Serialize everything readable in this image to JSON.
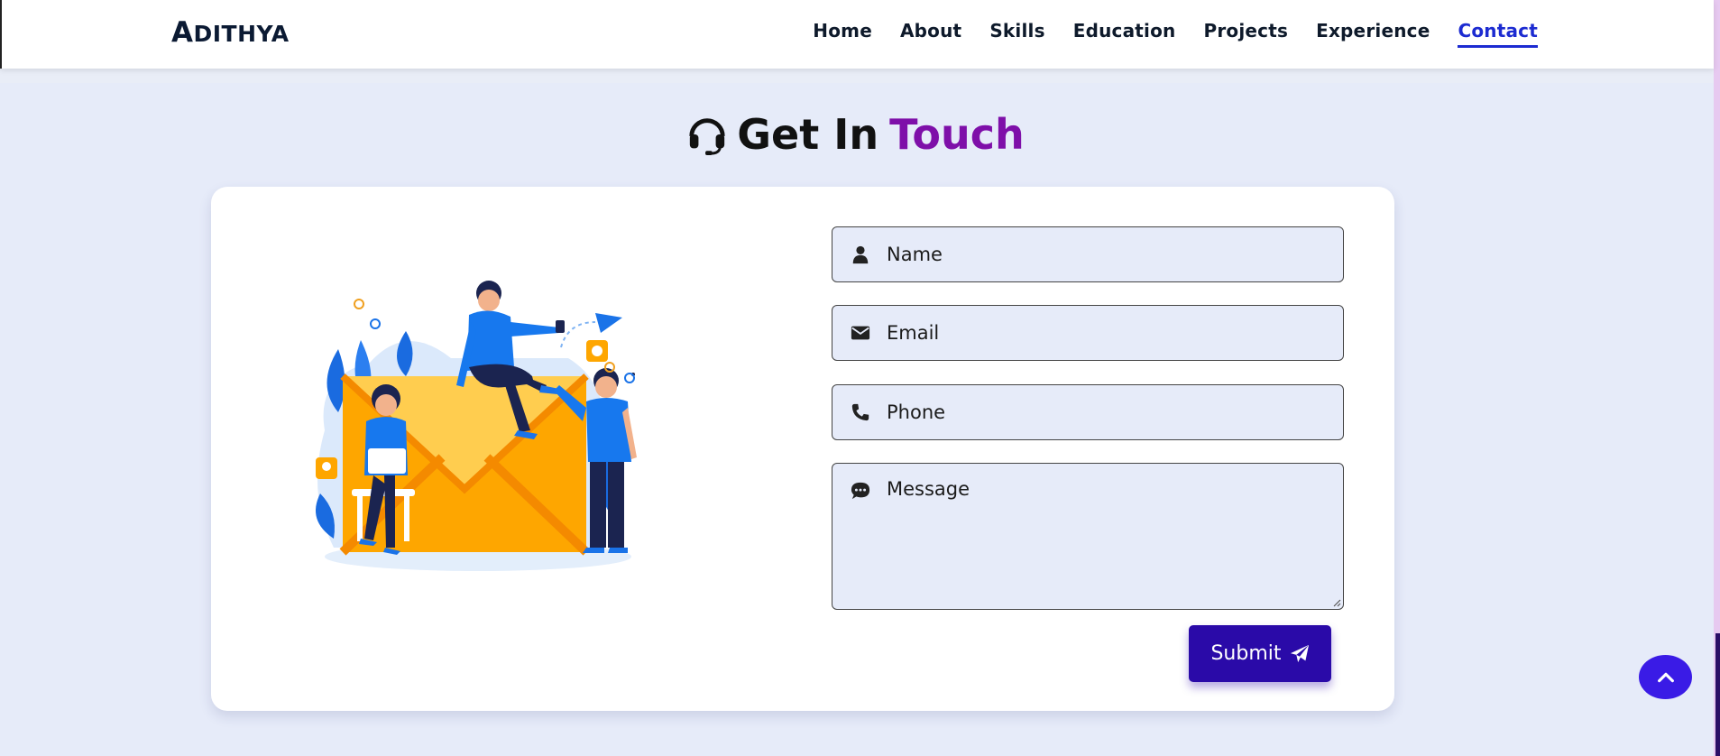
{
  "header": {
    "logo_first": "A",
    "logo_rest": "DITHYA",
    "nav": [
      {
        "label": "Home"
      },
      {
        "label": "About"
      },
      {
        "label": "Skills"
      },
      {
        "label": "Education"
      },
      {
        "label": "Projects"
      },
      {
        "label": "Experience"
      },
      {
        "label": "Contact",
        "active": true
      }
    ]
  },
  "section": {
    "title_main": "Get In",
    "title_accent": "Touch",
    "title_icon": "headset-icon"
  },
  "form": {
    "name_placeholder": "Name",
    "email_placeholder": "Email",
    "phone_placeholder": "Phone",
    "message_placeholder": "Message",
    "submit_label": "Submit",
    "icons": [
      "user-icon",
      "envelope-icon",
      "phone-icon",
      "comment-icon",
      "paper-plane-icon"
    ]
  },
  "scroll_top_icon": "chevron-up-icon",
  "colors": {
    "page_bg": "#e6ebf9",
    "accent_purple": "#7e0fa9",
    "nav_active": "#1c2bd1",
    "submit_bg": "#2a0aa8",
    "scroll_btn": "#3a1be6"
  }
}
